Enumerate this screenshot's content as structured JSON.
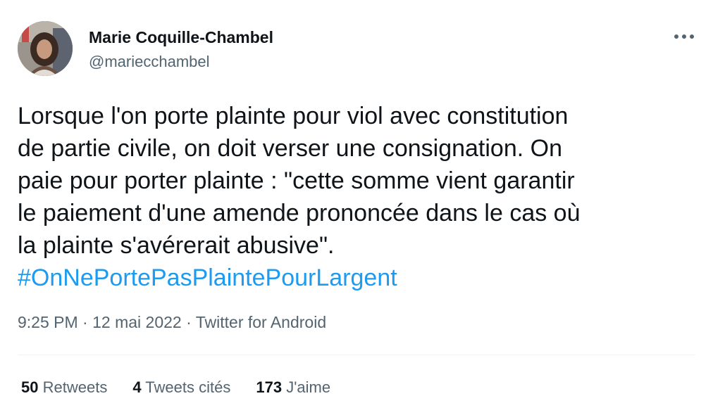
{
  "author": {
    "name": "Marie Coquille-Chambel",
    "handle": "@mariecchambel",
    "avatar_icon": "profile-photo"
  },
  "more_icon": "more-horizontal-icon",
  "tweet": {
    "text": "Lorsque l'on porte plainte pour viol avec constitution\nde partie civile, on doit verser une consignation. On\npaie pour porter plainte : \"cette somme vient garantir\nle paiement d'une amende prononcée dans le cas où\nla plainte s'avérerait abusive\".",
    "hashtag": "#OnNePortePasPlaintePourLargent"
  },
  "meta": {
    "time": "9:25 PM",
    "separator": "·",
    "date": "12 mai 2022",
    "source": "Twitter for Android"
  },
  "stats": {
    "retweets_count": "50",
    "retweets_label": "Retweets",
    "quotes_count": "4",
    "quotes_label": "Tweets cités",
    "likes_count": "173",
    "likes_label": "J'aime"
  },
  "colors": {
    "text": "#0f1419",
    "secondary": "#536471",
    "link": "#1d9bf0",
    "divider": "#eff3f4"
  }
}
